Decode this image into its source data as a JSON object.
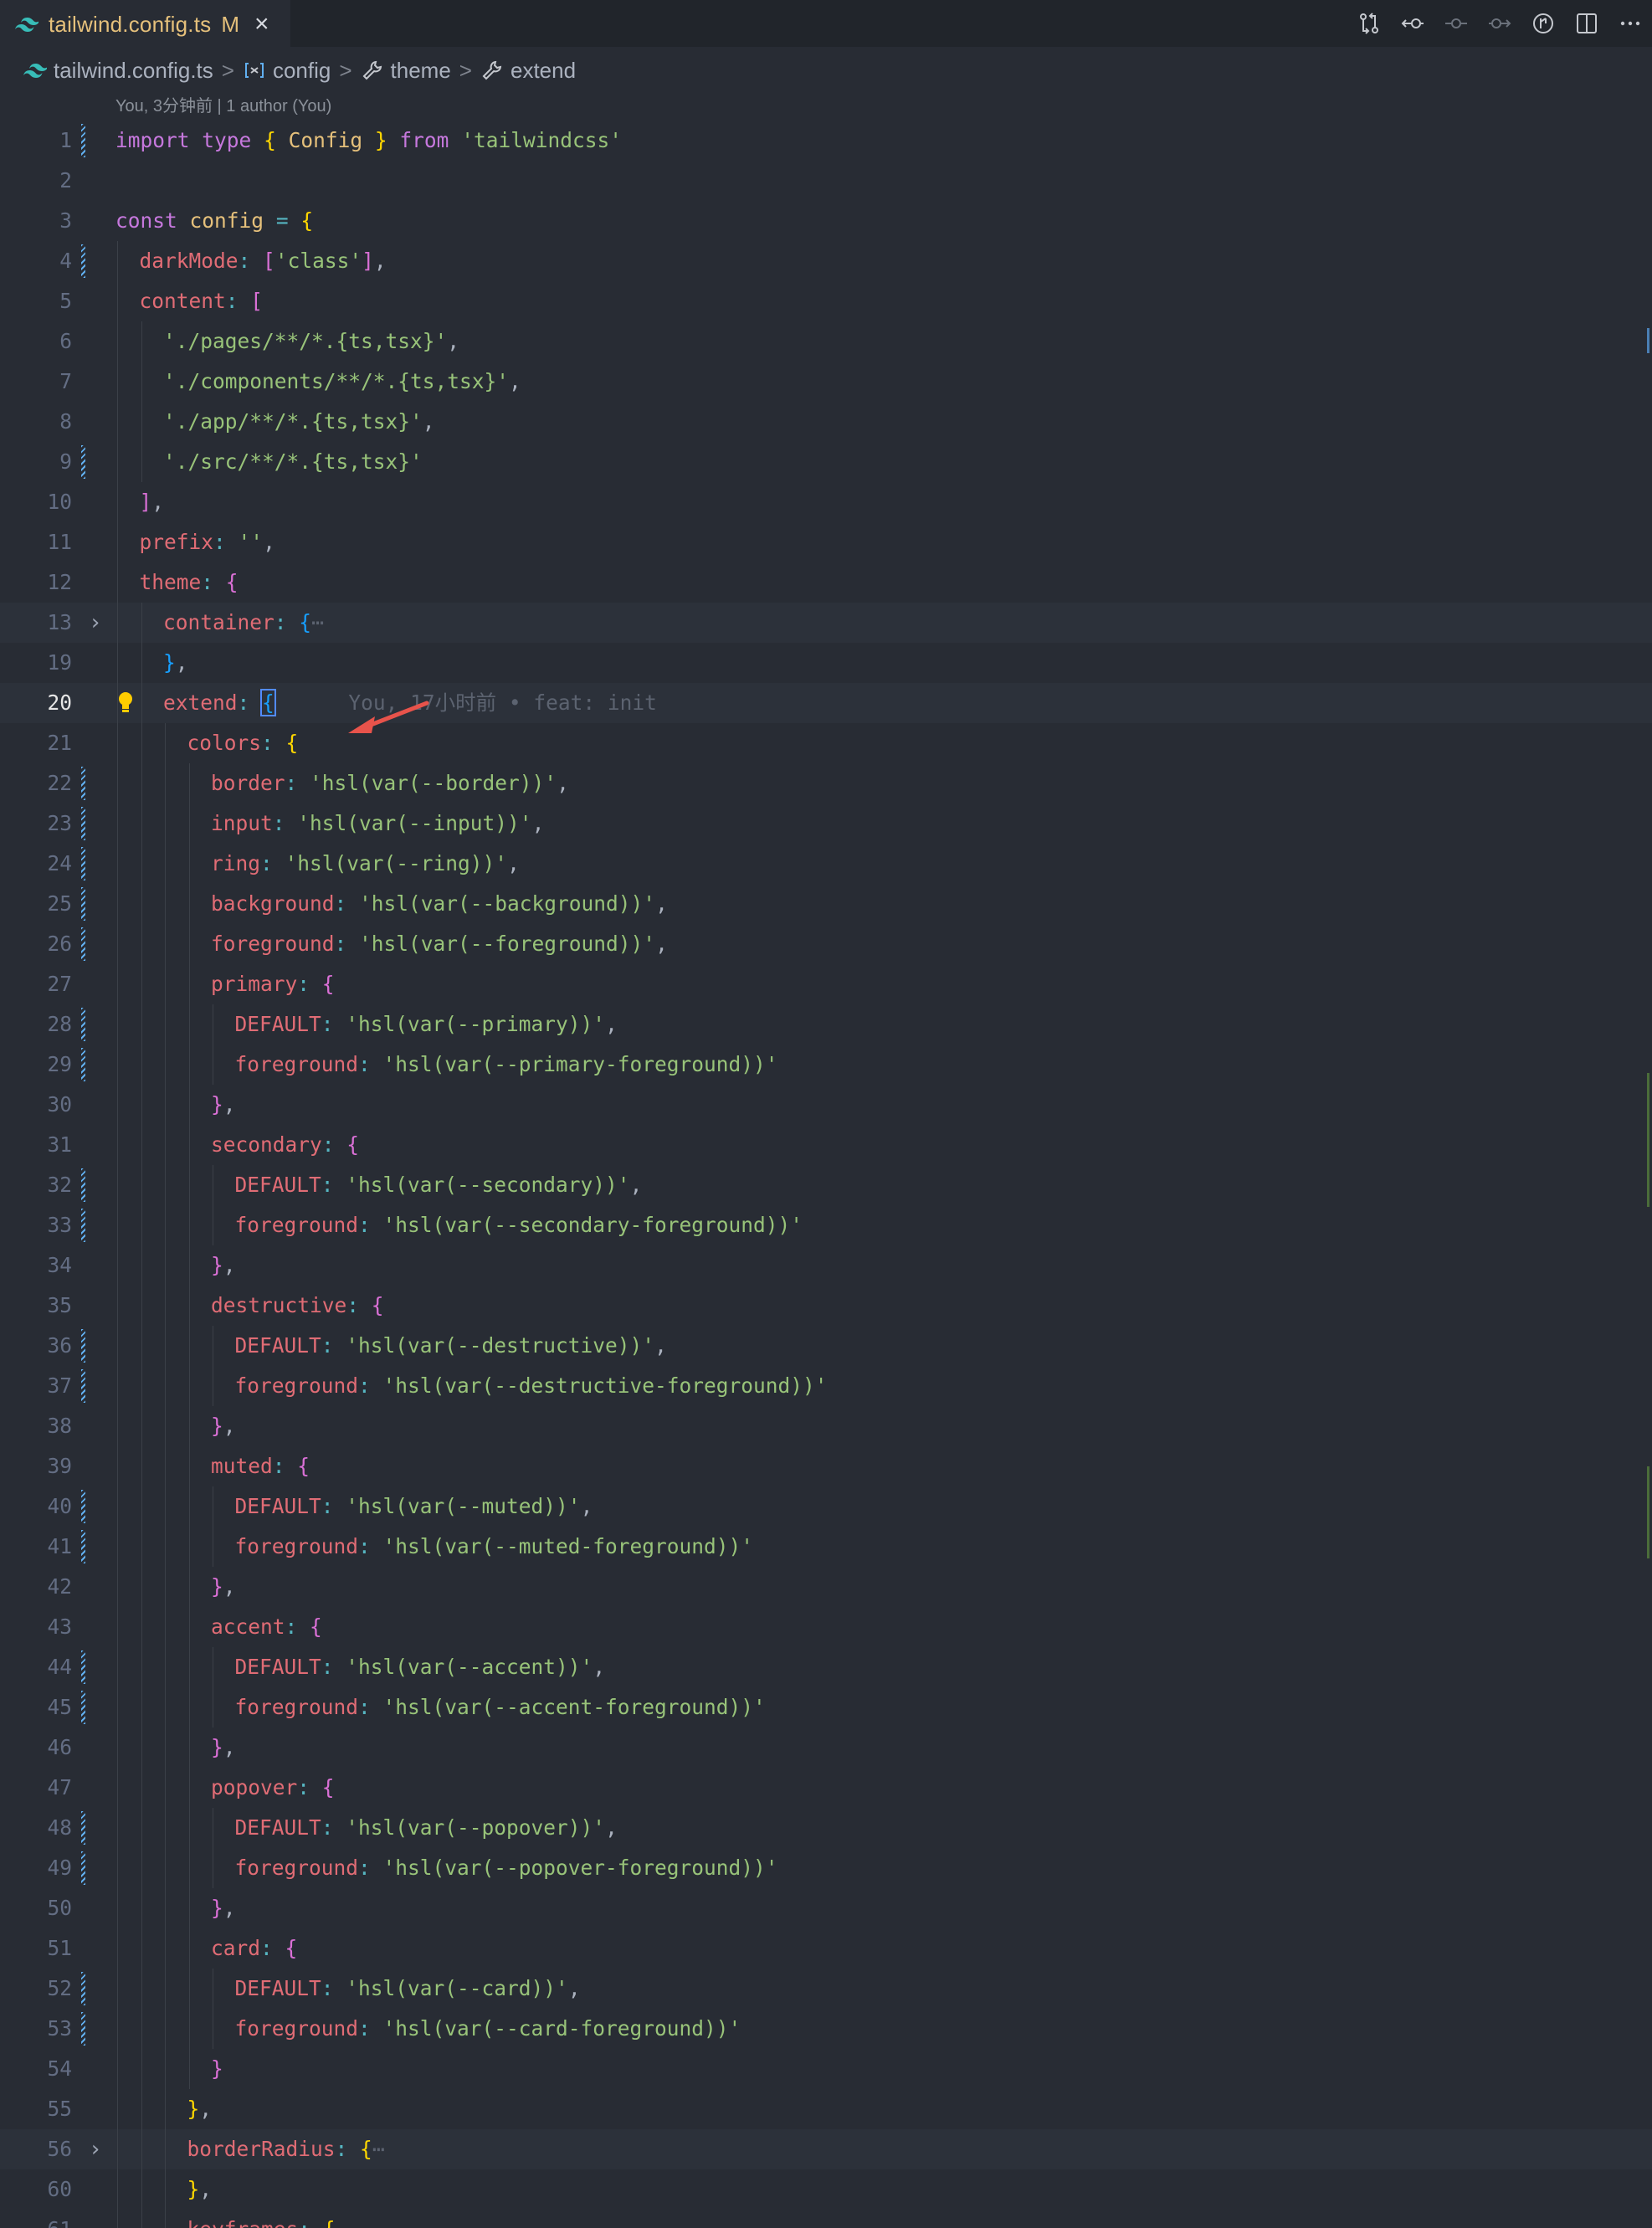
{
  "tab": {
    "filename": "tailwind.config.ts",
    "modified": "M",
    "close": "×"
  },
  "actions": [
    "git-compare-icon",
    "go-back-icon",
    "commit-icon",
    "go-forward-icon",
    "timeline-icon",
    "split-editor-icon",
    "more-icon"
  ],
  "breadcrumb": {
    "file": "tailwind.config.ts",
    "b1": "config",
    "b2": "theme",
    "b3": "extend",
    "sep": ">"
  },
  "codelens": "You, 3分钟前 | 1 author (You)",
  "blame": "You, 17小时前 • feat: init",
  "colors": {
    "background": "#282c34",
    "tabbar": "#21252b",
    "accent": "#61afef"
  },
  "lines": [
    {
      "n": "1",
      "i": 0,
      "mark": true,
      "t": [
        [
          "kw",
          "import"
        ],
        [
          "pu",
          " "
        ],
        [
          "kw",
          "type"
        ],
        [
          "pu",
          " "
        ],
        [
          "br",
          "{"
        ],
        [
          "pu",
          " "
        ],
        [
          "ty",
          "Config"
        ],
        [
          "pu",
          " "
        ],
        [
          "br",
          "}"
        ],
        [
          "pu",
          " "
        ],
        [
          "kw",
          "from"
        ],
        [
          "pu",
          " "
        ],
        [
          "st",
          "'tailwindcss'"
        ]
      ]
    },
    {
      "n": "2",
      "i": 0,
      "t": []
    },
    {
      "n": "3",
      "i": 0,
      "t": [
        [
          "kw",
          "const"
        ],
        [
          "pu",
          " "
        ],
        [
          "vr",
          "config"
        ],
        [
          "pu",
          " "
        ],
        [
          "op",
          "="
        ],
        [
          "pu",
          " "
        ],
        [
          "br",
          "{"
        ]
      ]
    },
    {
      "n": "4",
      "i": 1,
      "mark": true,
      "t": [
        [
          "pr",
          "darkMode"
        ],
        [
          "op",
          ":"
        ],
        [
          "pu",
          " "
        ],
        [
          "br2",
          "["
        ],
        [
          "st",
          "'class'"
        ],
        [
          "br2",
          "]"
        ],
        [
          "pu",
          ","
        ]
      ]
    },
    {
      "n": "5",
      "i": 1,
      "t": [
        [
          "pr",
          "content"
        ],
        [
          "op",
          ":"
        ],
        [
          "pu",
          " "
        ],
        [
          "br2",
          "["
        ]
      ]
    },
    {
      "n": "6",
      "i": 2,
      "t": [
        [
          "st",
          "'./pages/**/*.{ts,tsx}'"
        ],
        [
          "pu",
          ","
        ]
      ]
    },
    {
      "n": "7",
      "i": 2,
      "t": [
        [
          "st",
          "'./components/**/*.{ts,tsx}'"
        ],
        [
          "pu",
          ","
        ]
      ]
    },
    {
      "n": "8",
      "i": 2,
      "t": [
        [
          "st",
          "'./app/**/*.{ts,tsx}'"
        ],
        [
          "pu",
          ","
        ]
      ]
    },
    {
      "n": "9",
      "i": 2,
      "mark": true,
      "t": [
        [
          "st",
          "'./src/**/*.{ts,tsx}'"
        ]
      ]
    },
    {
      "n": "10",
      "i": 1,
      "t": [
        [
          "br2",
          "]"
        ],
        [
          "pu",
          ","
        ]
      ]
    },
    {
      "n": "11",
      "i": 1,
      "t": [
        [
          "pr",
          "prefix"
        ],
        [
          "op",
          ":"
        ],
        [
          "pu",
          " "
        ],
        [
          "st",
          "''"
        ],
        [
          "pu",
          ","
        ]
      ]
    },
    {
      "n": "12",
      "i": 1,
      "t": [
        [
          "pr",
          "theme"
        ],
        [
          "op",
          ":"
        ],
        [
          "pu",
          " "
        ],
        [
          "br2",
          "{"
        ]
      ]
    },
    {
      "n": "13",
      "i": 2,
      "fold": true,
      "hl": true,
      "t": [
        [
          "pr",
          "container"
        ],
        [
          "op",
          ":"
        ],
        [
          "pu",
          " "
        ],
        [
          "br3",
          "{"
        ],
        [
          "ghost",
          "⋯"
        ]
      ]
    },
    {
      "n": "19",
      "i": 2,
      "t": [
        [
          "br3",
          "}"
        ],
        [
          "pu",
          ","
        ]
      ]
    },
    {
      "n": "20",
      "i": 2,
      "cur": true,
      "bulb": true,
      "hl": true,
      "t": [
        [
          "pr",
          "extend"
        ],
        [
          "op",
          ":"
        ],
        [
          "pu",
          " "
        ],
        [
          "br3 cursor-box",
          "{"
        ]
      ],
      "blame": true
    },
    {
      "n": "21",
      "i": 3,
      "t": [
        [
          "pr",
          "colors"
        ],
        [
          "op",
          ":"
        ],
        [
          "pu",
          " "
        ],
        [
          "br",
          "{"
        ]
      ]
    },
    {
      "n": "22",
      "i": 4,
      "mark": true,
      "t": [
        [
          "pr",
          "border"
        ],
        [
          "op",
          ":"
        ],
        [
          "pu",
          " "
        ],
        [
          "st",
          "'hsl(var(--border))'"
        ],
        [
          "pu",
          ","
        ]
      ]
    },
    {
      "n": "23",
      "i": 4,
      "mark": true,
      "t": [
        [
          "pr",
          "input"
        ],
        [
          "op",
          ":"
        ],
        [
          "pu",
          " "
        ],
        [
          "st",
          "'hsl(var(--input))'"
        ],
        [
          "pu",
          ","
        ]
      ]
    },
    {
      "n": "24",
      "i": 4,
      "mark": true,
      "t": [
        [
          "pr",
          "ring"
        ],
        [
          "op",
          ":"
        ],
        [
          "pu",
          " "
        ],
        [
          "st",
          "'hsl(var(--ring))'"
        ],
        [
          "pu",
          ","
        ]
      ]
    },
    {
      "n": "25",
      "i": 4,
      "mark": true,
      "t": [
        [
          "pr",
          "background"
        ],
        [
          "op",
          ":"
        ],
        [
          "pu",
          " "
        ],
        [
          "st",
          "'hsl(var(--background))'"
        ],
        [
          "pu",
          ","
        ]
      ]
    },
    {
      "n": "26",
      "i": 4,
      "mark": true,
      "t": [
        [
          "pr",
          "foreground"
        ],
        [
          "op",
          ":"
        ],
        [
          "pu",
          " "
        ],
        [
          "st",
          "'hsl(var(--foreground))'"
        ],
        [
          "pu",
          ","
        ]
      ]
    },
    {
      "n": "27",
      "i": 4,
      "t": [
        [
          "pr",
          "primary"
        ],
        [
          "op",
          ":"
        ],
        [
          "pu",
          " "
        ],
        [
          "br2",
          "{"
        ]
      ]
    },
    {
      "n": "28",
      "i": 5,
      "mark": true,
      "t": [
        [
          "pr",
          "DEFAULT"
        ],
        [
          "op",
          ":"
        ],
        [
          "pu",
          " "
        ],
        [
          "st",
          "'hsl(var(--primary))'"
        ],
        [
          "pu",
          ","
        ]
      ]
    },
    {
      "n": "29",
      "i": 5,
      "mark": true,
      "t": [
        [
          "pr",
          "foreground"
        ],
        [
          "op",
          ":"
        ],
        [
          "pu",
          " "
        ],
        [
          "st",
          "'hsl(var(--primary-foreground))'"
        ]
      ]
    },
    {
      "n": "30",
      "i": 4,
      "t": [
        [
          "br2",
          "}"
        ],
        [
          "pu",
          ","
        ]
      ]
    },
    {
      "n": "31",
      "i": 4,
      "t": [
        [
          "pr",
          "secondary"
        ],
        [
          "op",
          ":"
        ],
        [
          "pu",
          " "
        ],
        [
          "br2",
          "{"
        ]
      ]
    },
    {
      "n": "32",
      "i": 5,
      "mark": true,
      "t": [
        [
          "pr",
          "DEFAULT"
        ],
        [
          "op",
          ":"
        ],
        [
          "pu",
          " "
        ],
        [
          "st",
          "'hsl(var(--secondary))'"
        ],
        [
          "pu",
          ","
        ]
      ]
    },
    {
      "n": "33",
      "i": 5,
      "mark": true,
      "t": [
        [
          "pr",
          "foreground"
        ],
        [
          "op",
          ":"
        ],
        [
          "pu",
          " "
        ],
        [
          "st",
          "'hsl(var(--secondary-foreground))'"
        ]
      ]
    },
    {
      "n": "34",
      "i": 4,
      "t": [
        [
          "br2",
          "}"
        ],
        [
          "pu",
          ","
        ]
      ]
    },
    {
      "n": "35",
      "i": 4,
      "t": [
        [
          "pr",
          "destructive"
        ],
        [
          "op",
          ":"
        ],
        [
          "pu",
          " "
        ],
        [
          "br2",
          "{"
        ]
      ]
    },
    {
      "n": "36",
      "i": 5,
      "mark": true,
      "t": [
        [
          "pr",
          "DEFAULT"
        ],
        [
          "op",
          ":"
        ],
        [
          "pu",
          " "
        ],
        [
          "st",
          "'hsl(var(--destructive))'"
        ],
        [
          "pu",
          ","
        ]
      ]
    },
    {
      "n": "37",
      "i": 5,
      "mark": true,
      "t": [
        [
          "pr",
          "foreground"
        ],
        [
          "op",
          ":"
        ],
        [
          "pu",
          " "
        ],
        [
          "st",
          "'hsl(var(--destructive-foreground))'"
        ]
      ]
    },
    {
      "n": "38",
      "i": 4,
      "t": [
        [
          "br2",
          "}"
        ],
        [
          "pu",
          ","
        ]
      ]
    },
    {
      "n": "39",
      "i": 4,
      "t": [
        [
          "pr",
          "muted"
        ],
        [
          "op",
          ":"
        ],
        [
          "pu",
          " "
        ],
        [
          "br2",
          "{"
        ]
      ]
    },
    {
      "n": "40",
      "i": 5,
      "mark": true,
      "t": [
        [
          "pr",
          "DEFAULT"
        ],
        [
          "op",
          ":"
        ],
        [
          "pu",
          " "
        ],
        [
          "st",
          "'hsl(var(--muted))'"
        ],
        [
          "pu",
          ","
        ]
      ]
    },
    {
      "n": "41",
      "i": 5,
      "mark": true,
      "t": [
        [
          "pr",
          "foreground"
        ],
        [
          "op",
          ":"
        ],
        [
          "pu",
          " "
        ],
        [
          "st",
          "'hsl(var(--muted-foreground))'"
        ]
      ]
    },
    {
      "n": "42",
      "i": 4,
      "t": [
        [
          "br2",
          "}"
        ],
        [
          "pu",
          ","
        ]
      ]
    },
    {
      "n": "43",
      "i": 4,
      "t": [
        [
          "pr",
          "accent"
        ],
        [
          "op",
          ":"
        ],
        [
          "pu",
          " "
        ],
        [
          "br2",
          "{"
        ]
      ]
    },
    {
      "n": "44",
      "i": 5,
      "mark": true,
      "t": [
        [
          "pr",
          "DEFAULT"
        ],
        [
          "op",
          ":"
        ],
        [
          "pu",
          " "
        ],
        [
          "st",
          "'hsl(var(--accent))'"
        ],
        [
          "pu",
          ","
        ]
      ]
    },
    {
      "n": "45",
      "i": 5,
      "mark": true,
      "t": [
        [
          "pr",
          "foreground"
        ],
        [
          "op",
          ":"
        ],
        [
          "pu",
          " "
        ],
        [
          "st",
          "'hsl(var(--accent-foreground))'"
        ]
      ]
    },
    {
      "n": "46",
      "i": 4,
      "t": [
        [
          "br2",
          "}"
        ],
        [
          "pu",
          ","
        ]
      ]
    },
    {
      "n": "47",
      "i": 4,
      "t": [
        [
          "pr",
          "popover"
        ],
        [
          "op",
          ":"
        ],
        [
          "pu",
          " "
        ],
        [
          "br2",
          "{"
        ]
      ]
    },
    {
      "n": "48",
      "i": 5,
      "mark": true,
      "t": [
        [
          "pr",
          "DEFAULT"
        ],
        [
          "op",
          ":"
        ],
        [
          "pu",
          " "
        ],
        [
          "st",
          "'hsl(var(--popover))'"
        ],
        [
          "pu",
          ","
        ]
      ]
    },
    {
      "n": "49",
      "i": 5,
      "mark": true,
      "t": [
        [
          "pr",
          "foreground"
        ],
        [
          "op",
          ":"
        ],
        [
          "pu",
          " "
        ],
        [
          "st",
          "'hsl(var(--popover-foreground))'"
        ]
      ]
    },
    {
      "n": "50",
      "i": 4,
      "t": [
        [
          "br2",
          "}"
        ],
        [
          "pu",
          ","
        ]
      ]
    },
    {
      "n": "51",
      "i": 4,
      "t": [
        [
          "pr",
          "card"
        ],
        [
          "op",
          ":"
        ],
        [
          "pu",
          " "
        ],
        [
          "br2",
          "{"
        ]
      ]
    },
    {
      "n": "52",
      "i": 5,
      "mark": true,
      "t": [
        [
          "pr",
          "DEFAULT"
        ],
        [
          "op",
          ":"
        ],
        [
          "pu",
          " "
        ],
        [
          "st",
          "'hsl(var(--card))'"
        ],
        [
          "pu",
          ","
        ]
      ]
    },
    {
      "n": "53",
      "i": 5,
      "mark": true,
      "t": [
        [
          "pr",
          "foreground"
        ],
        [
          "op",
          ":"
        ],
        [
          "pu",
          " "
        ],
        [
          "st",
          "'hsl(var(--card-foreground))'"
        ]
      ]
    },
    {
      "n": "54",
      "i": 4,
      "t": [
        [
          "br2",
          "}"
        ]
      ]
    },
    {
      "n": "55",
      "i": 3,
      "t": [
        [
          "br",
          "}"
        ],
        [
          "pu",
          ","
        ]
      ]
    },
    {
      "n": "56",
      "i": 3,
      "fold": true,
      "hl": true,
      "t": [
        [
          "pr",
          "borderRadius"
        ],
        [
          "op",
          ":"
        ],
        [
          "pu",
          " "
        ],
        [
          "br",
          "{"
        ],
        [
          "ghost",
          "⋯"
        ]
      ]
    },
    {
      "n": "60",
      "i": 3,
      "t": [
        [
          "br",
          "}"
        ],
        [
          "pu",
          ","
        ]
      ]
    },
    {
      "n": "61",
      "i": 3,
      "t": [
        [
          "pr",
          "keyframes"
        ],
        [
          "op",
          ":"
        ],
        [
          "pu",
          " "
        ],
        [
          "br",
          "{"
        ]
      ]
    }
  ]
}
